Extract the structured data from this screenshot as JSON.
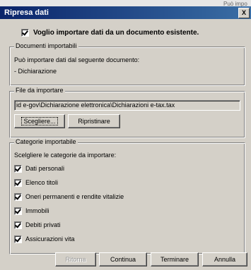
{
  "background": {
    "partial_text": "Può impo"
  },
  "window": {
    "title": "Ripresa dati",
    "close_glyph": "X"
  },
  "main_checkbox": {
    "label": "Voglio importare dati da un documento esistente.",
    "checked": true
  },
  "documents": {
    "legend": "Documenti importabili",
    "line1": "Può importare dati dal seguente documento:",
    "line2": "- Dichiarazione"
  },
  "file": {
    "legend": "File da importare",
    "path": "id e-gov\\Dichiarazione elettronica\\Dichiarazioni e-tax.tax",
    "choose_label": "Scegliere...",
    "restore_label": "Ripristinare"
  },
  "categories": {
    "legend": "Categorie importabile",
    "instruction": "Scelgliere le categorie da importare:",
    "items": [
      {
        "label": "Dati personali",
        "checked": true
      },
      {
        "label": "Elenco titoli",
        "checked": true
      },
      {
        "label": "Oneri permanenti e rendite vitalizie",
        "checked": true
      },
      {
        "label": "Immobili",
        "checked": true
      },
      {
        "label": "Debiti privati",
        "checked": true
      },
      {
        "label": "Assicurazioni vita",
        "checked": true
      }
    ]
  },
  "footer": {
    "back_label": "Ritorna",
    "continue_label": "Continua",
    "finish_label": "Terminare",
    "cancel_label": "Annulla"
  }
}
